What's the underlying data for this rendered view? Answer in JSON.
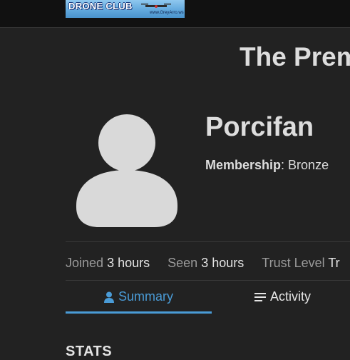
{
  "header": {
    "logo_text": "DRONE CLUB",
    "logo_url": "www.GreyArro.ws"
  },
  "site_title": "The Prem",
  "profile": {
    "username": "Porcifan",
    "membership_label": "Membership",
    "membership_value": "Bronze"
  },
  "stats": [
    {
      "label": "Joined",
      "value": "3 hours"
    },
    {
      "label": "Seen",
      "value": "3 hours"
    },
    {
      "label": "Trust Level",
      "value": "Tr"
    }
  ],
  "tabs": [
    {
      "label": "Summary",
      "icon": "user-icon",
      "active": true
    },
    {
      "label": "Activity",
      "icon": "list-icon",
      "active": false
    }
  ],
  "section": {
    "heading": "STATS"
  },
  "colors": {
    "background": "#222222",
    "accent": "#4a9bd6",
    "avatar": "#d9d9d9"
  }
}
